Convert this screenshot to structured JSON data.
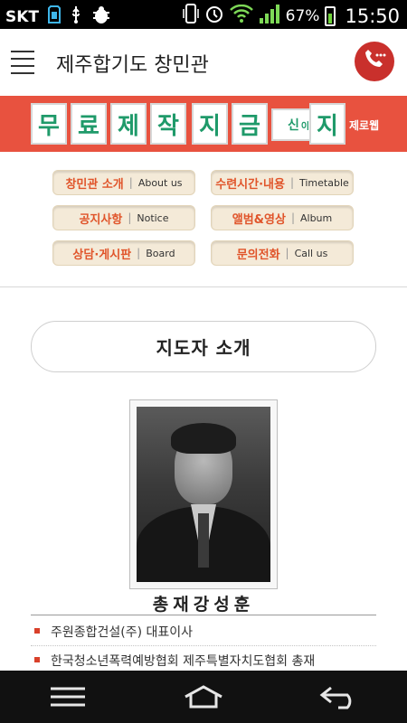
{
  "status": {
    "carrier": "SKT",
    "battery_pct": "67%",
    "time": "15:50",
    "colors": {
      "bar_bg": "#000000",
      "signal": "#7ed957"
    },
    "icons": [
      "sd-card-icon",
      "usb-icon",
      "bug-icon",
      "phone-vibrate-icon",
      "alarm-icon",
      "wifi-icon",
      "signal-icon",
      "battery-charging-icon"
    ]
  },
  "header": {
    "title": "제주합기도 창민관",
    "menu_icon": "hamburger-icon",
    "call_icon": "phone-call-icon",
    "call_color": "#c9302c"
  },
  "banner": {
    "bg_color": "#e8523f",
    "chars": [
      "무",
      "료",
      "제",
      "작",
      "지",
      "금"
    ],
    "small_chars": [
      "신",
      "이"
    ],
    "last_char": "지",
    "tag": "제로웹"
  },
  "nav": {
    "items": [
      {
        "ko": "창민관 소개",
        "en": "About us"
      },
      {
        "ko": "수련시간·내용",
        "en": "Timetable"
      },
      {
        "ko": "공지사항",
        "en": "Notice"
      },
      {
        "ko": "앨범&영상",
        "en": "Album"
      },
      {
        "ko": "상담·게시판",
        "en": "Board"
      },
      {
        "ko": "문의전화",
        "en": "Call us"
      }
    ],
    "separator": "|"
  },
  "section": {
    "title": "지도자 소개"
  },
  "profile": {
    "name": "총재강성훈",
    "items": [
      "주원종합건설(주) 대표이사",
      "한국청소년폭력예방협회 제주특별자치도협회 총재"
    ]
  },
  "softnav": {
    "icons": [
      "menu-icon",
      "home-icon",
      "back-icon"
    ]
  }
}
